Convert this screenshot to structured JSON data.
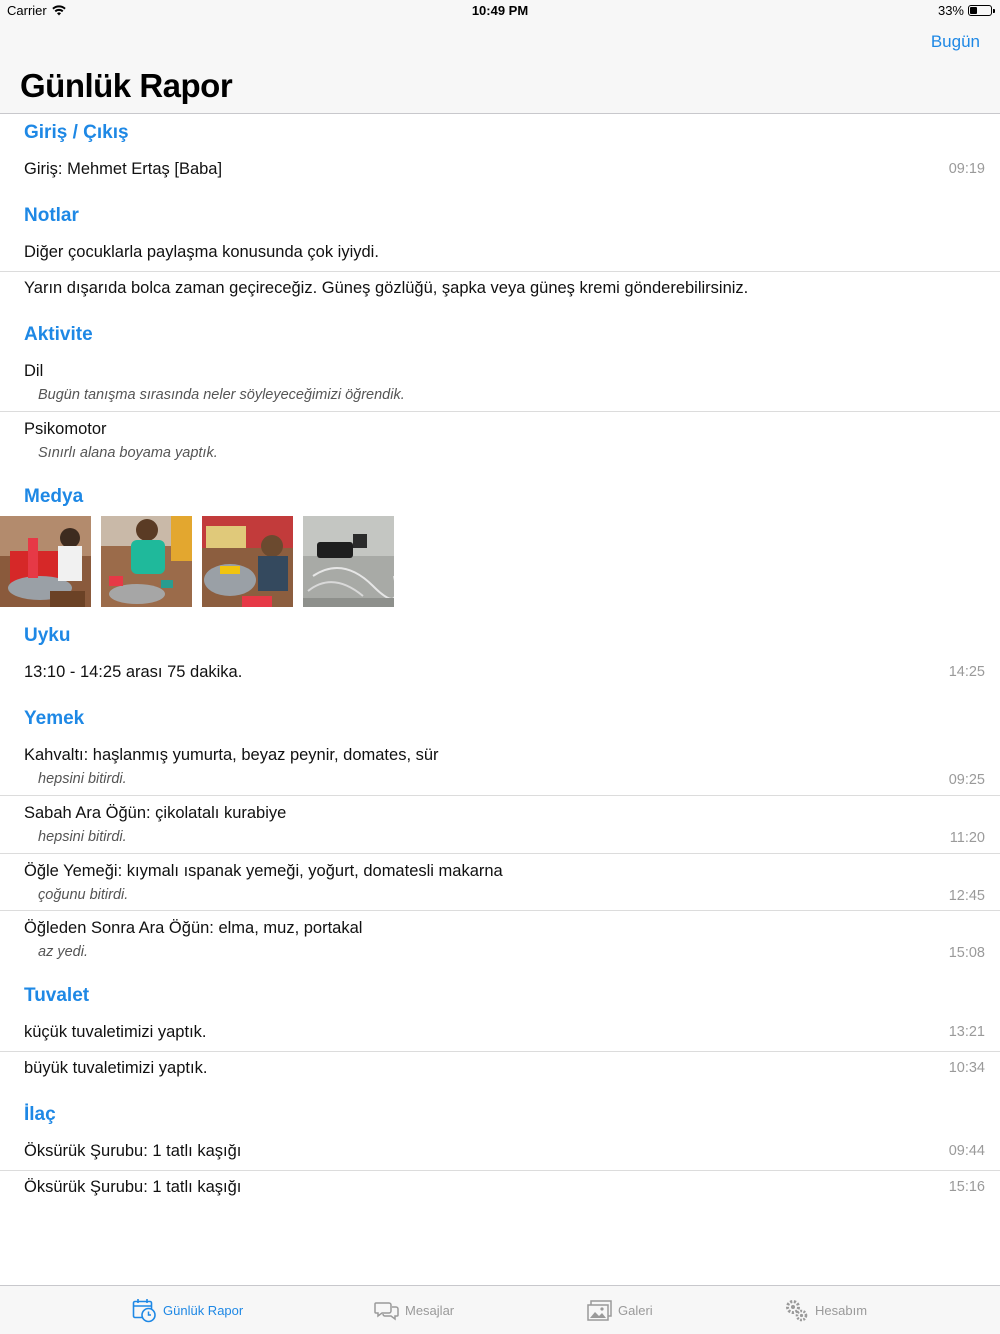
{
  "status": {
    "carrier": "Carrier",
    "time": "10:49 PM",
    "battery": "33%"
  },
  "nav": {
    "today": "Bugün",
    "title": "Günlük Rapor"
  },
  "sections": {
    "checkin": {
      "title": "Giriş / Çıkış",
      "rows": [
        {
          "text": "Giriş: Mehmet Ertaş [Baba]",
          "time": "09:19"
        }
      ]
    },
    "notes": {
      "title": "Notlar",
      "rows": [
        {
          "text": "Diğer çocuklarla paylaşma konusunda çok iyiydi."
        },
        {
          "text": "Yarın dışarıda bolca zaman geçireceğiz. Güneş gözlüğü, şapka veya güneş kremi gönderebilirsiniz."
        }
      ]
    },
    "activity": {
      "title": "Aktivite",
      "rows": [
        {
          "text": "Dil",
          "sub": "Bugün tanışma sırasında neler söyleyeceğimizi öğrendik."
        },
        {
          "text": "Psikomotor",
          "sub": "Sınırlı alana boyama yaptık."
        }
      ]
    },
    "media": {
      "title": "Medya"
    },
    "sleep": {
      "title": "Uyku",
      "rows": [
        {
          "text": "13:10 - 14:25 arası 75 dakika.",
          "time": "14:25"
        }
      ]
    },
    "food": {
      "title": "Yemek",
      "rows": [
        {
          "text": "Kahvaltı: haşlanmış yumurta, beyaz peynir, domates, sür",
          "sub": "hepsini bitirdi.",
          "time": "09:25"
        },
        {
          "text": "Sabah Ara Öğün: çikolatalı kurabiye",
          "sub": "hepsini bitirdi.",
          "time": "11:20"
        },
        {
          "text": "Öğle Yemeği: kıymalı ıspanak yemeği, yoğurt, domatesli makarna",
          "sub": "çoğunu bitirdi.",
          "time": "12:45"
        },
        {
          "text": "Öğleden Sonra Ara Öğün: elma, muz, portakal",
          "sub": "az yedi.",
          "time": "15:08"
        }
      ]
    },
    "toilet": {
      "title": "Tuvalet",
      "rows": [
        {
          "text": "küçük tuvaletimizi yaptık.",
          "time": "13:21"
        },
        {
          "text": "büyük tuvaletimizi yaptık.",
          "time": "10:34"
        }
      ]
    },
    "medicine": {
      "title": "İlaç",
      "rows": [
        {
          "text": "Öksürük Şurubu: 1 tatlı kaşığı",
          "time": "09:44"
        },
        {
          "text": "Öksürük Şurubu: 1 tatlı kaşığı",
          "time": "15:16"
        }
      ]
    }
  },
  "tabs": [
    {
      "label": "Günlük Rapor",
      "icon": "calendar-clock-icon",
      "active": true
    },
    {
      "label": "Mesajlar",
      "icon": "chat-bubbles-icon"
    },
    {
      "label": "Galeri",
      "icon": "gallery-icon"
    },
    {
      "label": "Hesabım",
      "icon": "gears-icon"
    }
  ],
  "colors": {
    "accent": "#1e88e5",
    "muted": "#9a9a9a",
    "bar": "#f7f7f7"
  }
}
